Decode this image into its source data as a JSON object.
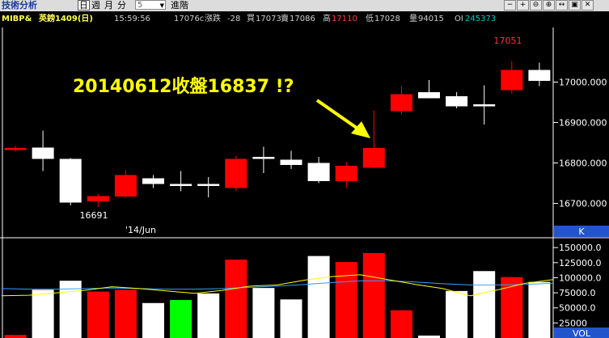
{
  "toolbar": {
    "title": "技術分析",
    "periods": [
      "日",
      "週",
      "月",
      "分"
    ],
    "selected_period": "日",
    "interval_value": "5",
    "advanced": "進階",
    "window_buttons": [
      "−",
      "+",
      "⊖",
      "⊕",
      "↔",
      "▣",
      "✕"
    ]
  },
  "quote": {
    "symbol": "MIBP&",
    "name": "英鎊1409(日)",
    "time": "15:59:56",
    "last": "17076c",
    "change_label": "漲跌",
    "change": "-28",
    "bid_label": "買",
    "bid": "17073",
    "ask_label": "賣",
    "ask": "17086",
    "high_label": "高",
    "high": "17110",
    "low_label": "低",
    "low": "17028",
    "vol_label": "量",
    "volume": "94015",
    "oi_label": "OI",
    "oi": "245373"
  },
  "annotation": "20140612收盤16837 !?",
  "colors": {
    "up": "#ff0000",
    "down": "#ffffff",
    "highlight": "#00ff00",
    "ma_short": "#ffff00",
    "ma_long": "#3aa0ff",
    "axis": "#ffffff",
    "panel_label_bg": "#2255cc"
  },
  "chart_data": [
    {
      "type": "candlestick",
      "price_ticks": [
        "17000.000",
        "16900.000",
        "16800.000",
        "16700.000"
      ],
      "ylim": [
        16615,
        17135
      ],
      "date_label": "'14/Jun",
      "annotations": [
        {
          "text": "17051"
        },
        {
          "text": "16691"
        }
      ],
      "candles": [
        {
          "o": 16832,
          "h": 16842,
          "l": 16828,
          "c": 16837,
          "color": "up"
        },
        {
          "o": 16838,
          "h": 16880,
          "l": 16780,
          "c": 16810,
          "color": "down"
        },
        {
          "o": 16810,
          "h": 16812,
          "l": 16695,
          "c": 16702,
          "color": "down"
        },
        {
          "o": 16705,
          "h": 16723,
          "l": 16691,
          "c": 16718,
          "color": "up"
        },
        {
          "o": 16717,
          "h": 16782,
          "l": 16715,
          "c": 16770,
          "color": "up"
        },
        {
          "o": 16762,
          "h": 16770,
          "l": 16738,
          "c": 16748,
          "color": "down"
        },
        {
          "o": 16748,
          "h": 16780,
          "l": 16730,
          "c": 16743,
          "color": "down"
        },
        {
          "o": 16748,
          "h": 16765,
          "l": 16715,
          "c": 16743,
          "color": "down"
        },
        {
          "o": 16738,
          "h": 16818,
          "l": 16730,
          "c": 16810,
          "color": "up"
        },
        {
          "o": 16815,
          "h": 16840,
          "l": 16775,
          "c": 16810,
          "color": "down"
        },
        {
          "o": 16808,
          "h": 16830,
          "l": 16785,
          "c": 16795,
          "color": "down"
        },
        {
          "o": 16800,
          "h": 16815,
          "l": 16750,
          "c": 16755,
          "color": "down"
        },
        {
          "o": 16755,
          "h": 16802,
          "l": 16738,
          "c": 16793,
          "color": "up"
        },
        {
          "o": 16788,
          "h": 16930,
          "l": 16787,
          "c": 16837,
          "color": "up"
        },
        {
          "o": 16928,
          "h": 16990,
          "l": 16920,
          "c": 16970,
          "color": "up"
        },
        {
          "o": 16975,
          "h": 17005,
          "l": 16960,
          "c": 16960,
          "color": "down"
        },
        {
          "o": 16965,
          "h": 16975,
          "l": 16935,
          "c": 16940,
          "color": "down"
        },
        {
          "o": 16945,
          "h": 16992,
          "l": 16895,
          "c": 16940,
          "color": "down"
        },
        {
          "o": 16980,
          "h": 17051,
          "l": 16972,
          "c": 17030,
          "color": "up"
        },
        {
          "o": 17030,
          "h": 17048,
          "l": 16990,
          "c": 17003,
          "color": "down"
        }
      ]
    },
    {
      "type": "bar",
      "label": "VOL",
      "panel_tag": "K",
      "volume_ticks": [
        "150000.0",
        "125000.0",
        "100000.0",
        "75000.0",
        "50000.0",
        "25000"
      ],
      "ylim": [
        0,
        165000
      ],
      "volumes": [
        {
          "v": 5000,
          "color": "up"
        },
        {
          "v": 80000,
          "color": "down"
        },
        {
          "v": 95000,
          "color": "down"
        },
        {
          "v": 77000,
          "color": "up"
        },
        {
          "v": 80000,
          "color": "up"
        },
        {
          "v": 58000,
          "color": "down"
        },
        {
          "v": 63000,
          "color": "highlight"
        },
        {
          "v": 74000,
          "color": "down"
        },
        {
          "v": 130000,
          "color": "up"
        },
        {
          "v": 83000,
          "color": "down"
        },
        {
          "v": 64000,
          "color": "down"
        },
        {
          "v": 136000,
          "color": "down"
        },
        {
          "v": 126000,
          "color": "up"
        },
        {
          "v": 141000,
          "color": "up"
        },
        {
          "v": 46000,
          "color": "up"
        },
        {
          "v": 4000,
          "color": "down"
        },
        {
          "v": 78000,
          "color": "down"
        },
        {
          "v": 111000,
          "color": "down"
        },
        {
          "v": 101000,
          "color": "up"
        },
        {
          "v": 93000,
          "color": "down"
        }
      ],
      "ma_short": [
        70000,
        71000,
        75000,
        79000,
        85000,
        82000,
        78000,
        74000,
        79000,
        86000,
        88000,
        96000,
        102000,
        105000,
        97000,
        89000,
        82000,
        70000,
        80000,
        91000,
        97000
      ],
      "ma_long": [
        82000,
        81000,
        81000,
        82000,
        83000,
        82000,
        81000,
        81000,
        82000,
        84000,
        86000,
        89000,
        92000,
        95000,
        95000,
        93000,
        90000,
        88000,
        88000,
        89000,
        91000
      ]
    }
  ]
}
